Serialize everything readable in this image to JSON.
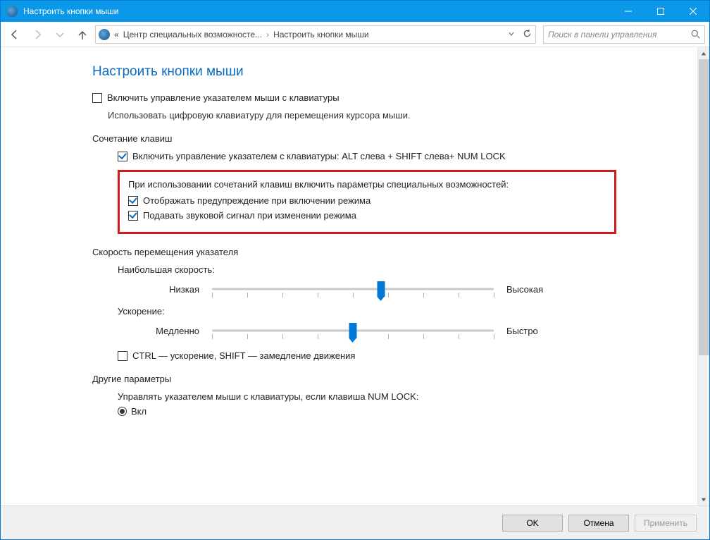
{
  "window": {
    "title": "Настроить кнопки мыши"
  },
  "breadcrumb": {
    "item1": "Центр специальных возможносте...",
    "item2": "Настроить кнопки мыши",
    "prefix": "«"
  },
  "search": {
    "placeholder": "Поиск в панели управления"
  },
  "page": {
    "title": "Настроить кнопки мыши"
  },
  "main_cb": {
    "label": "Включить управление указателем мыши с клавиатуры"
  },
  "main_sub": "Использовать цифровую клавиатуру для перемещения курсора мыши.",
  "group1": {
    "label": "Сочетание клавиш",
    "cb1": "Включить управление указателем с клавиатуры: ALT слева + SHIFT слева+ NUM LOCK",
    "box_desc": "При использовании сочетаний клавиш включить параметры специальных возможностей:",
    "box_cb1": "Отображать предупреждение при включении режима",
    "box_cb2": "Подавать звуковой сигнал при изменении режима"
  },
  "group2": {
    "label": "Скорость перемещения указателя",
    "s1_label": "Наибольшая скорость:",
    "s1_low": "Низкая",
    "s1_high": "Высокая",
    "s2_label": "Ускорение:",
    "s2_low": "Медленно",
    "s2_high": "Быстро",
    "cb": "CTRL — ускорение, SHIFT — замедление движения"
  },
  "group3": {
    "label": "Другие параметры",
    "desc": "Управлять указателем мыши с клавиатуры, если клавиша NUM LOCK:",
    "radio1": "Вкл"
  },
  "footer": {
    "ok": "OK",
    "cancel": "Отмена",
    "apply": "Применить"
  }
}
